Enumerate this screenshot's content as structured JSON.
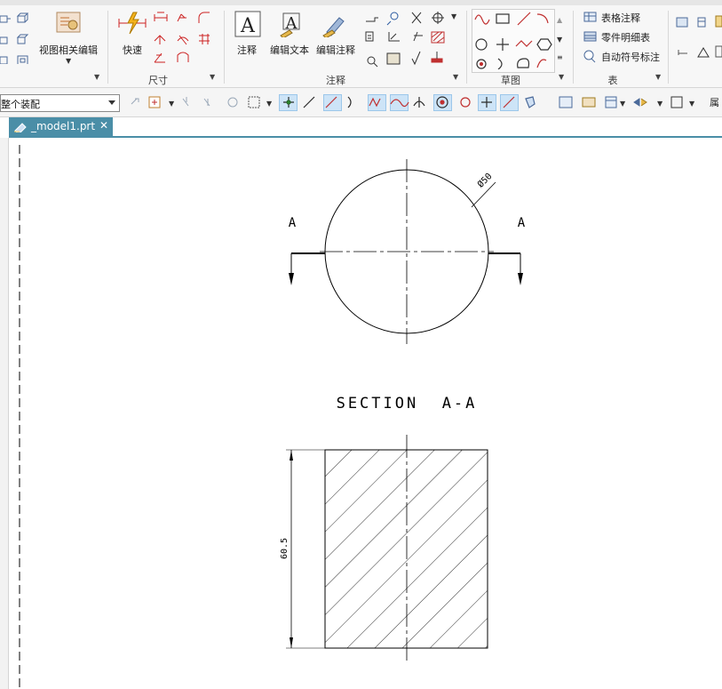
{
  "ribbon": {
    "groups": {
      "view": {
        "edit_label": "视图相关编辑"
      },
      "dimension": {
        "quick_label": "快速",
        "group_label": "尺寸"
      },
      "annotation": {
        "note_label": "注释",
        "edit_text_label": "编辑文本",
        "edit_annotation_label": "编辑注释",
        "group_label": "注释"
      },
      "sketch": {
        "group_label": "草图"
      },
      "table": {
        "tabular_note_label": "表格注释",
        "parts_list_label": "零件明细表",
        "auto_balloon_label": "自动符号标注",
        "group_label": "表"
      }
    }
  },
  "toolbar": {
    "selection_filter": "整个装配",
    "right_cut_label": "属"
  },
  "document": {
    "tab_label": "_model1.prt",
    "close_glyph": "✕"
  },
  "drawing": {
    "section_title": "SECTION  A-A",
    "cut_label_left": "A",
    "cut_label_right": "A",
    "diameter_dim": "Ø50",
    "height_dim": "60.5"
  },
  "colors": {
    "tab_active": "#4a8ea7",
    "hatch": "#000000",
    "toggle_highlight": "#cde4f7"
  }
}
